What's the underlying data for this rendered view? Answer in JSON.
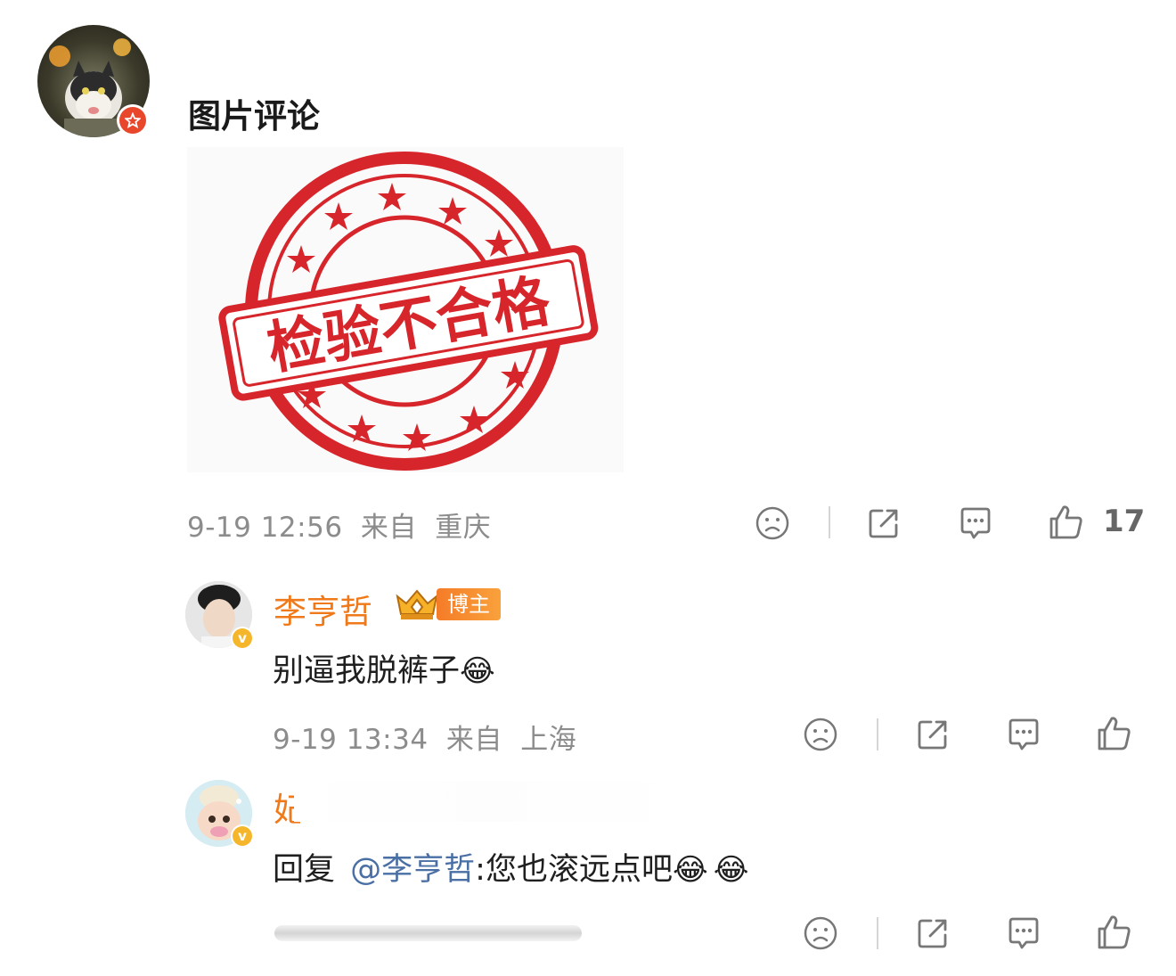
{
  "post": {
    "title": "图片评论",
    "image": {
      "stamp_text": "检验不合格"
    },
    "meta": {
      "date_time": "9-19 12:56",
      "from_label": "来自",
      "location": "重庆"
    },
    "likes_count": "17"
  },
  "comments": [
    {
      "username": "李亨哲",
      "badge_label": "博主",
      "text": "别逼我脱裤子",
      "emoji": "😂",
      "meta": {
        "date_time": "9-19 13:34",
        "from_label": "来自",
        "location": "上海"
      }
    },
    {
      "username": "妃",
      "reply_prefix": "回复",
      "mention": "@李亨哲",
      "text": ":您也滚远点吧",
      "emojis": [
        "😂",
        "😂"
      ]
    }
  ],
  "icons": {
    "dislike": "frown-face-icon",
    "share": "share-icon",
    "comment": "comment-bubble-icon",
    "like": "thumbs-up-icon",
    "verified": "verified-v-icon"
  },
  "colors": {
    "username_orange": "#f07a1a",
    "mention_blue": "#4a6fa5",
    "stamp_red": "#d7262b",
    "meta_gray": "#8c8c8c"
  }
}
